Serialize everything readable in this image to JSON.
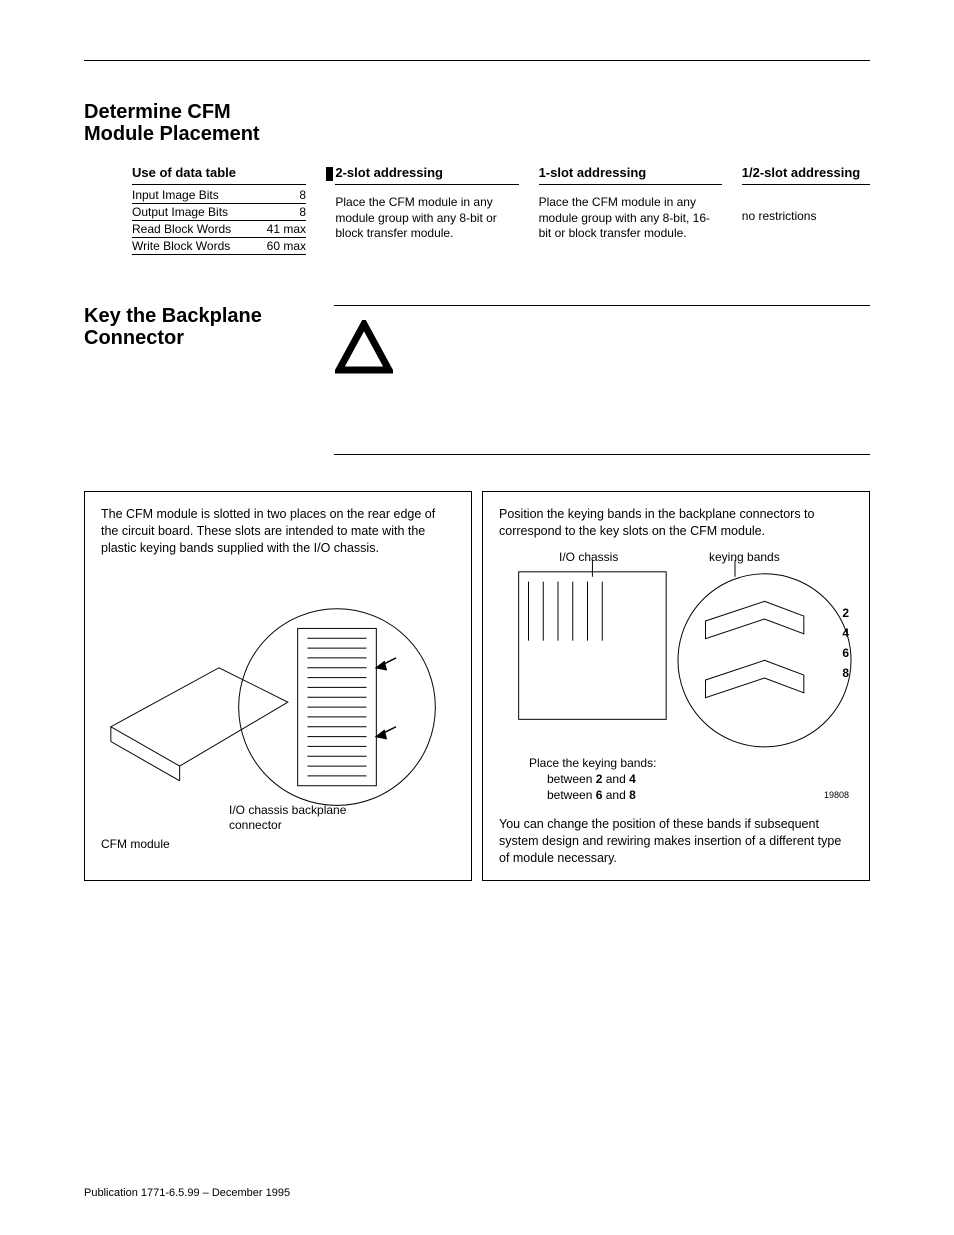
{
  "headings": {
    "section1": "Determine CFM Module Placement",
    "section2": "Key the Backplane Connector"
  },
  "data_table": {
    "header": "Use of data table",
    "rows": [
      {
        "label": "Input Image Bits",
        "value": "8"
      },
      {
        "label": "Output Image Bits",
        "value": "8"
      },
      {
        "label": "Read Block Words",
        "value": "41 max"
      },
      {
        "label": "Write Block Words",
        "value": "60 max"
      }
    ]
  },
  "addressing": {
    "two_slot": {
      "header": "2-slot addressing",
      "body": "Place the CFM module in any module group with any 8-bit or block transfer module."
    },
    "one_slot": {
      "header": "1-slot addressing",
      "body": "Place the CFM module in any module group with any 8-bit, 16-bit or block transfer module."
    },
    "half_slot": {
      "header": "1/2-slot addressing",
      "body": "no restrictions"
    }
  },
  "diagram_left": {
    "intro": "The CFM module is slotted in two places on the rear edge of the circuit board.  These slots are intended to mate with the plastic keying bands supplied with the I/O chassis.",
    "label_io": "I/O chassis backplane connector",
    "label_cfm": "CFM module"
  },
  "diagram_right": {
    "intro": "Position the keying bands in the backplane connectors to correspond to the key slots on the CFM module.",
    "label_io_chassis": "I/O chassis",
    "label_keying_bands": "keying bands",
    "place_heading": "Place the keying bands:",
    "place_line1_a": "between ",
    "place_line1_b": "2",
    "place_line1_c": " and ",
    "place_line1_d": "4",
    "place_line2_a": "between ",
    "place_line2_b": "6",
    "place_line2_c": " and ",
    "place_line2_d": "8",
    "scale": [
      "2",
      "4",
      "6",
      "8"
    ],
    "figno": "19808",
    "footnote": "You can change the position of these bands if subsequent system design and rewiring makes insertion of a different type of module necessary."
  },
  "publication": "Publication 1771-6.5.99 – December 1995"
}
